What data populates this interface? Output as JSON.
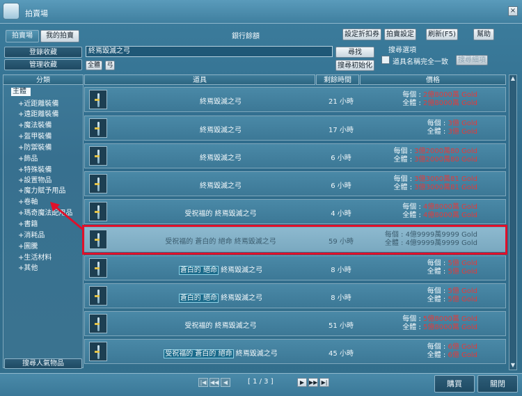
{
  "window": {
    "title": "拍賣場"
  },
  "tabs": [
    {
      "label": "拍賣場"
    },
    {
      "label": "我的拍賣"
    }
  ],
  "bank_label": "銀行餘額",
  "top_buttons": {
    "coupon": "設定折扣券",
    "settings": "拍賣設定",
    "refresh": "刷新(F5)",
    "help": "幫助"
  },
  "left_buttons": {
    "register": "登錄收藏",
    "manage": "管理收藏"
  },
  "search": {
    "value": "終焉毀滅之弓",
    "filter_all": "全體",
    "filter_bow": "弓",
    "find": "尋找",
    "reset": "搜尋初始化"
  },
  "search_options": {
    "title": "搜尋選項",
    "exact": "道具名稱完全一致",
    "detail": "搜尋細項"
  },
  "category_header": "分類",
  "categories": [
    "主體",
    "近距離裝備",
    "遠距離裝備",
    "魔法裝備",
    "盔甲裝備",
    "防禦裝備",
    "飾品",
    "特殊裝備",
    "設置物品",
    "魔力賦予用品",
    "卷軸",
    "瑪奇魔法配用品",
    "書籍",
    "消耗品",
    "圖騰",
    "生活材料",
    "其他"
  ],
  "popular_button": "搜尋人氣物品",
  "columns": {
    "item": "道具",
    "time": "剩餘時間",
    "price": "價格"
  },
  "price_labels": {
    "each": "每個 : ",
    "total": "全體 : "
  },
  "rows": [
    {
      "prefix": "",
      "name": "終焉毀滅之弓",
      "time": "21 小時",
      "each": "2億8000萬 Gold",
      "total": "2億8000萬 Gold"
    },
    {
      "prefix": "",
      "name": "終焉毀滅之弓",
      "time": "17 小時",
      "each": "3億 Gold",
      "total": "3億 Gold"
    },
    {
      "prefix": "",
      "name": "終焉毀滅之弓",
      "time": "6 小時",
      "each": "3億2000萬80 Gold",
      "total": "3億2000萬80 Gold"
    },
    {
      "prefix": "",
      "name": "終焉毀滅之弓",
      "time": "6 小時",
      "each": "3億3000萬81 Gold",
      "total": "3億3000萬81 Gold"
    },
    {
      "prefix": "受祝福的",
      "name": "終焉毀滅之弓",
      "time": "4 小時",
      "each": "4億8000萬 Gold",
      "total": "4億8000萬 Gold"
    },
    {
      "prefix": "受祝福的 蒼白的 絕命",
      "name": "終焉毀滅之弓",
      "time": "59 小時",
      "each": "4億9999萬9999 Gold",
      "total": "4億9999萬9999 Gold"
    },
    {
      "prefix": "蒼白的 絕命",
      "name": "終焉毀滅之弓",
      "time": "8 小時",
      "each": "5億 Gold",
      "total": "5億 Gold"
    },
    {
      "prefix": "蒼白的 絕命",
      "name": "終焉毀滅之弓",
      "time": "8 小時",
      "each": "5億 Gold",
      "total": "5億 Gold"
    },
    {
      "prefix": "受祝福的",
      "name": "終焉毀滅之弓",
      "time": "51 小時",
      "each": "5億8000萬 Gold",
      "total": "5億8000萬 Gold"
    },
    {
      "prefix": "受祝福的 蒼白的 絕命",
      "name": "終焉毀滅之弓",
      "time": "45 小時",
      "each": "6億 Gold",
      "total": "6億 Gold"
    }
  ],
  "pagination": {
    "label": "[ 1 / 3 ]"
  },
  "bottom_buttons": {
    "buy": "購買",
    "close": "關閉"
  },
  "colors": {
    "highlight_border": "#e0102a",
    "price_red": "#e23b3b"
  }
}
